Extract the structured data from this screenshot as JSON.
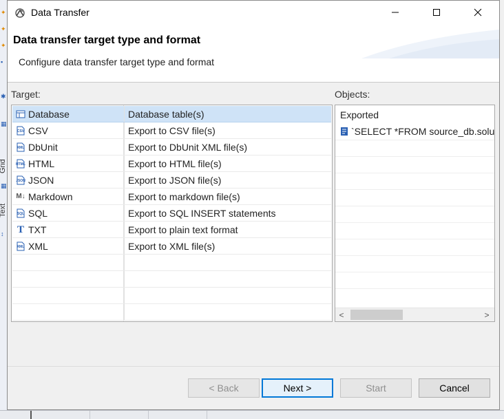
{
  "window": {
    "title": "Data Transfer"
  },
  "header": {
    "title": "Data transfer target type and format",
    "description": "Configure data transfer target type and format"
  },
  "background": {
    "tab_grid": "Grid",
    "tab_text": "Text"
  },
  "target_section": {
    "label": "Target:",
    "selected_index": 0,
    "items": [
      {
        "name": "Database",
        "description": "Database table(s)",
        "icon": "database-table-icon"
      },
      {
        "name": "CSV",
        "description": "Export to CSV file(s)",
        "icon": "csv-file-icon"
      },
      {
        "name": "DbUnit",
        "description": "Export to DbUnit XML file(s)",
        "icon": "xml-file-icon"
      },
      {
        "name": "HTML",
        "description": "Export to HTML file(s)",
        "icon": "html-file-icon"
      },
      {
        "name": "JSON",
        "description": "Export to JSON file(s)",
        "icon": "json-file-icon"
      },
      {
        "name": "Markdown",
        "description": "Export to markdown file(s)",
        "icon": "markdown-icon"
      },
      {
        "name": "SQL",
        "description": "Export to SQL INSERT statements",
        "icon": "sql-file-icon"
      },
      {
        "name": "TXT",
        "description": "Export to plain text format",
        "icon": "text-icon"
      },
      {
        "name": "XML",
        "description": "Export to XML file(s)",
        "icon": "xml-file-icon"
      }
    ]
  },
  "objects_section": {
    "label": "Objects:",
    "header": "Exported",
    "items": [
      {
        "text": "`SELECT *FROM source_db.solu",
        "icon": "query-icon"
      }
    ]
  },
  "buttons": {
    "back": "< Back",
    "next": "Next >",
    "start": "Start",
    "cancel": "Cancel"
  }
}
